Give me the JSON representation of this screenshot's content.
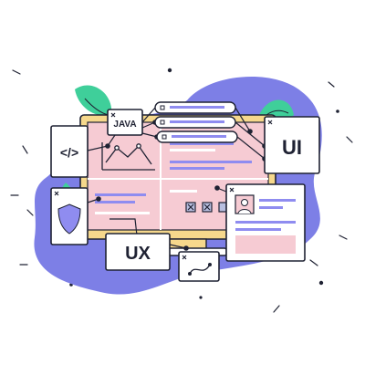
{
  "labels": {
    "java": "JAVA",
    "ui": "UI",
    "ux": "UX",
    "code": "</>"
  },
  "colors": {
    "blob": "#7d7fe6",
    "monitor_frame": "#f6d88c",
    "screen": "#f6cbd3",
    "card": "#ffffff",
    "stroke": "#1f2233",
    "accent_blue": "#8f8cf0",
    "accent_pink": "#f39cc0",
    "leaf_green": "#3fcf9a",
    "icon_grey": "#b8bfe0"
  },
  "icons": [
    "code-icon",
    "shield-icon",
    "user-avatar-icon",
    "close-icon",
    "curve-path-icon",
    "line-chart-icon"
  ]
}
